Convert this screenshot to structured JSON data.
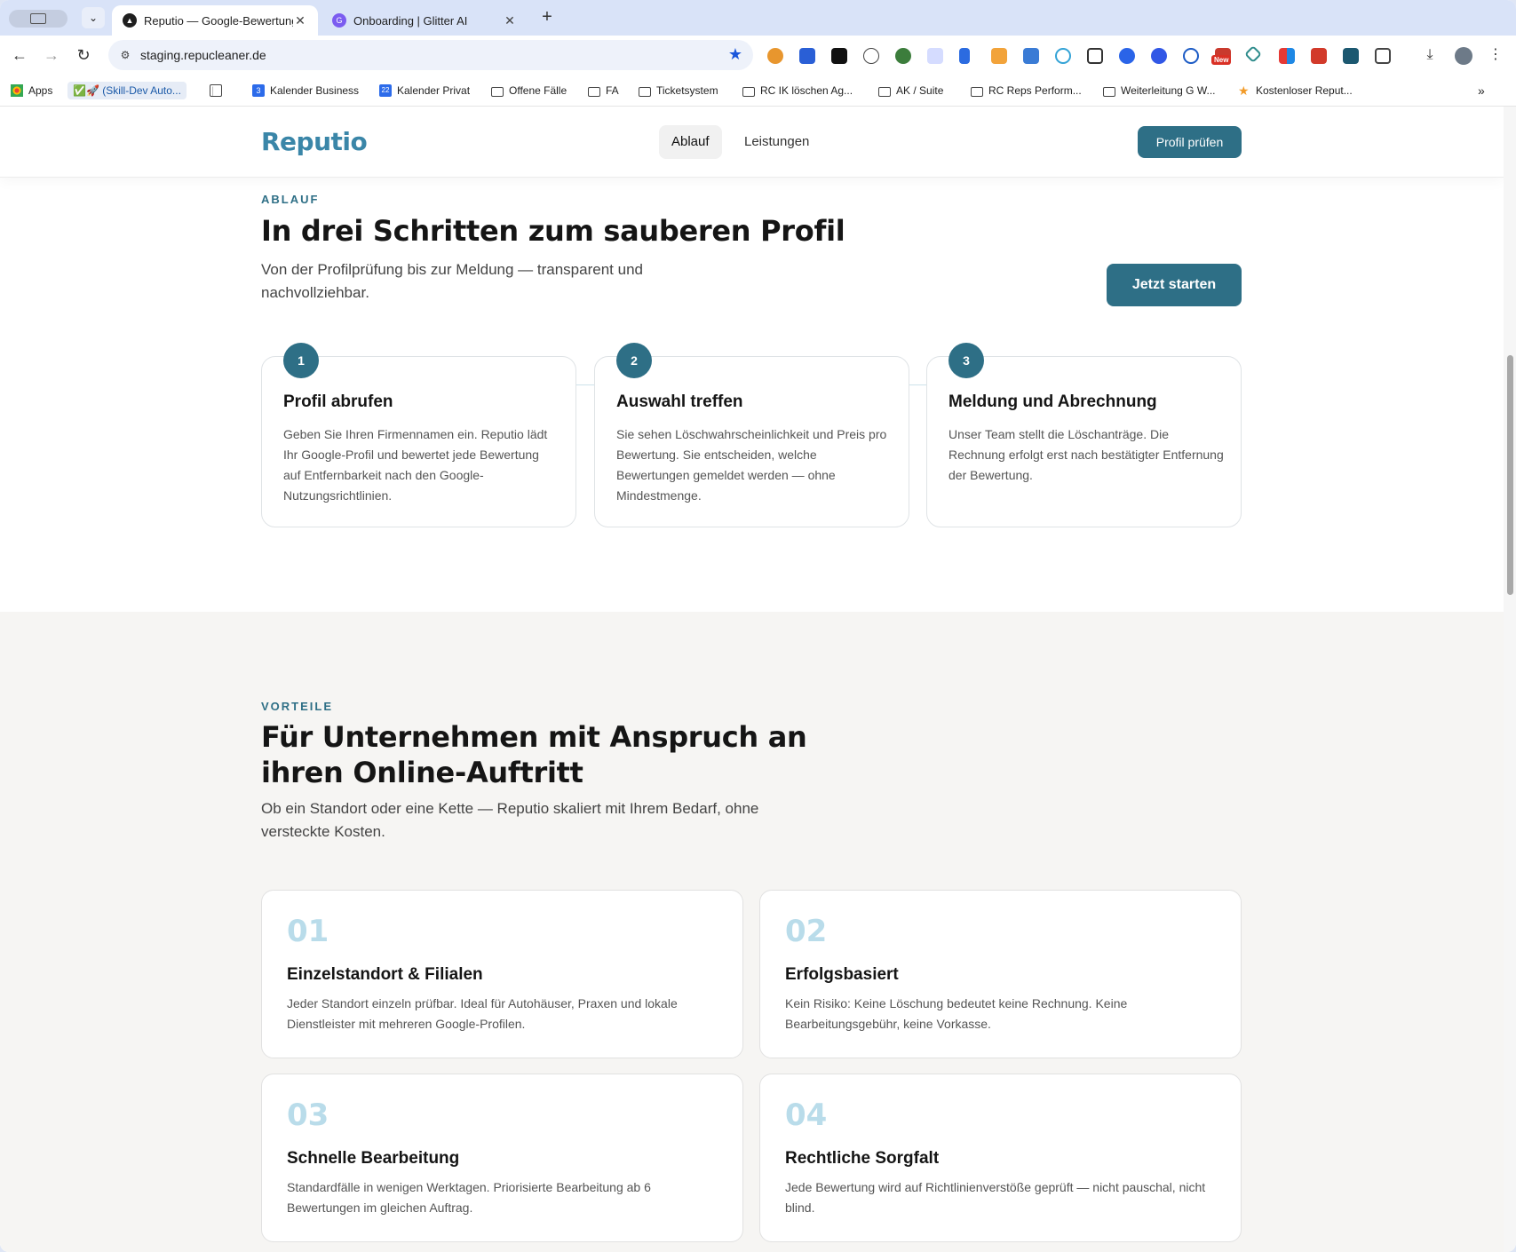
{
  "browser": {
    "tabs": [
      {
        "title": "Reputio — Google-Bewertungen",
        "active": true
      },
      {
        "title": "Onboarding | Glitter AI",
        "active": false
      }
    ],
    "url": "staging.repucleaner.de",
    "new_badge": "New",
    "bookmarks": [
      {
        "label": "Apps",
        "icon": "apps-grid-icon"
      },
      {
        "label": "✅🚀 (Skill-Dev Auto...",
        "icon": "none"
      },
      {
        "label": "",
        "icon": "tab-groups-icon"
      },
      {
        "label": "Kalender Business",
        "icon": "calendar-icon"
      },
      {
        "label": "Kalender Privat",
        "icon": "calendar-icon"
      },
      {
        "label": "Offene Fälle",
        "icon": "folder-icon"
      },
      {
        "label": "FA",
        "icon": "folder-icon"
      },
      {
        "label": "Ticketsystem",
        "icon": "folder-icon"
      },
      {
        "label": "RC IK löschen Ag...",
        "icon": "folder-icon"
      },
      {
        "label": "AK / Suite",
        "icon": "folder-icon"
      },
      {
        "label": "RC Reps Perform...",
        "icon": "folder-icon"
      },
      {
        "label": "Weiterleitung G W...",
        "icon": "folder-icon"
      },
      {
        "label": "Kostenloser Reput...",
        "icon": "star-icon"
      }
    ],
    "calendar_business_day": "3",
    "calendar_private_day": "22"
  },
  "header": {
    "logo": "Reputio",
    "nav": [
      "Ablauf",
      "Leistungen"
    ],
    "cta": "Profil prüfen"
  },
  "ablauf": {
    "eyebrow": "ABLAUF",
    "title": "In drei Schritten zum sauberen Profil",
    "lead": "Von der Profilprüfung bis zur Meldung — transparent und nachvollziehbar.",
    "cta": "Jetzt starten",
    "steps": [
      {
        "num": "1",
        "title": "Profil abrufen",
        "text": "Geben Sie Ihren Firmennamen ein. Reputio lädt Ihr Google-Profil und bewertet jede Bewertung auf Entfernbarkeit nach den Google-Nutzungsrichtlinien."
      },
      {
        "num": "2",
        "title": "Auswahl treffen",
        "text": "Sie sehen Löschwahrscheinlichkeit und Preis pro Bewertung. Sie entscheiden, welche Bewertungen gemeldet werden — ohne Mindestmenge."
      },
      {
        "num": "3",
        "title": "Meldung und Abrechnung",
        "text": "Unser Team stellt die Löschanträge. Die Rechnung erfolgt erst nach bestätigter Entfernung der Bewertung."
      }
    ]
  },
  "vorteile": {
    "eyebrow": "VORTEILE",
    "title": "Für Unternehmen mit Anspruch an ihren Online-Auftritt",
    "lead": "Ob ein Standort oder eine Kette — Reputio skaliert mit Ihrem Bedarf, ohne versteckte Kosten.",
    "features": [
      {
        "num": "01",
        "title": "Einzelstandort & Filialen",
        "text": "Jeder Standort einzeln prüfbar. Ideal für Autohäuser, Praxen und lokale Dienstleister mit mehreren Google-Profilen."
      },
      {
        "num": "02",
        "title": "Erfolgsbasiert",
        "text": "Kein Risiko: Keine Löschung bedeutet keine Rechnung. Keine Bearbeitungsgebühr, keine Vorkasse."
      },
      {
        "num": "03",
        "title": "Schnelle Bearbeitung",
        "text": "Standardfälle in wenigen Werktagen. Priorisierte Bearbeitung ab 6 Bewertungen im gleichen Auftrag."
      },
      {
        "num": "04",
        "title": "Rechtliche Sorgfalt",
        "text": "Jede Bewertung wird auf Richtlinienverstöße geprüft — nicht pauschal, nicht blind."
      }
    ]
  },
  "colors": {
    "brand": "#2e6f86",
    "logo": "#3a86a8",
    "number_light": "#b9dcea"
  }
}
